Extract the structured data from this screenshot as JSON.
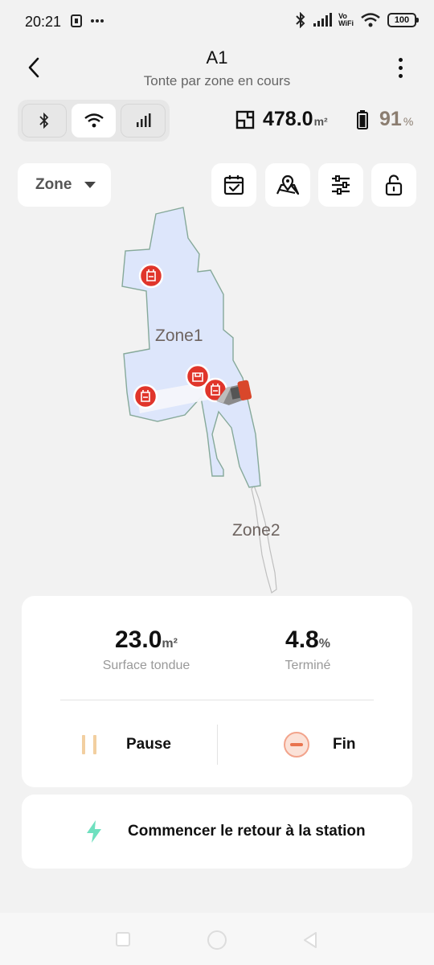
{
  "status_bar": {
    "time": "20:21",
    "vowifi_line1": "Vo",
    "vowifi_line2": "WiFi",
    "battery_level": "100"
  },
  "header": {
    "title": "A1",
    "subtitle": "Tonte par zone en cours"
  },
  "connectivity": {
    "options": [
      "bluetooth-icon",
      "wifi-icon",
      "cellular-icon"
    ],
    "active": "wifi-icon"
  },
  "area": {
    "value": "478.0",
    "unit": "m²"
  },
  "battery": {
    "value": "91",
    "unit": "%"
  },
  "zone_selector": {
    "label": "Zone"
  },
  "tools": [
    "calendar-check-icon",
    "map-pin-icon",
    "sliders-icon",
    "unlock-icon"
  ],
  "map": {
    "zones": [
      "Zone1",
      "Zone2"
    ],
    "colors": {
      "zone_fill": "#dde6fb",
      "zone_border": "#86a99a",
      "marker": "#e0352b",
      "mowed_path": "#f4f6fb"
    }
  },
  "stats": {
    "mowed_value": "23.0",
    "mowed_unit": "m²",
    "mowed_label": "Surface tondue",
    "done_value": "4.8",
    "done_unit": "%",
    "done_label": "Terminé"
  },
  "actions": {
    "pause_label": "Pause",
    "end_label": "Fin"
  },
  "return": {
    "label": "Commencer le retour à la station"
  }
}
